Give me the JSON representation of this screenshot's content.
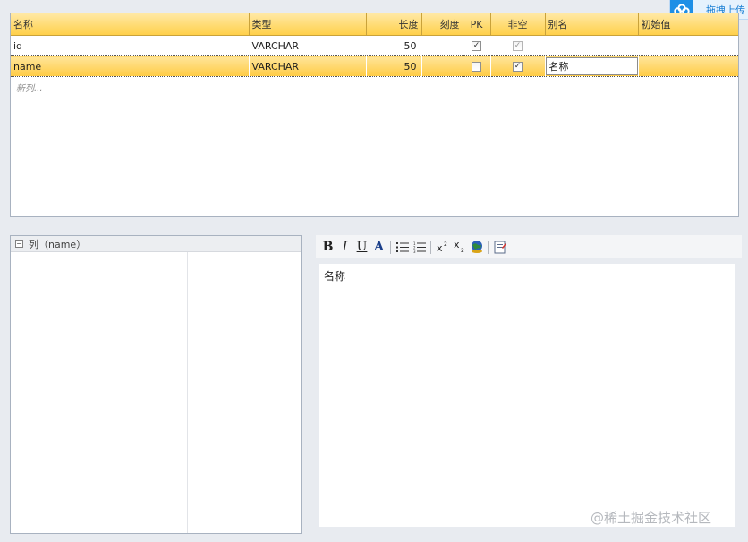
{
  "upload": {
    "label": "拖拽上传"
  },
  "grid": {
    "headers": {
      "name": "名称",
      "type": "类型",
      "length": "长度",
      "scale": "刻度",
      "pk": "PK",
      "notnull": "非空",
      "alias": "别名",
      "default": "初始值"
    },
    "rows": [
      {
        "name": "id",
        "type": "VARCHAR",
        "length": "50",
        "scale": "",
        "pk": true,
        "notnull": true,
        "alias": "",
        "default": ""
      },
      {
        "name": "name",
        "type": "VARCHAR",
        "length": "50",
        "scale": "",
        "pk": false,
        "notnull": true,
        "alias": "名称",
        "default": ""
      }
    ],
    "new_row_placeholder": "新列..."
  },
  "property_panel": {
    "title": "列（name）"
  },
  "editor": {
    "content": "名称"
  },
  "toolbar": {
    "bold": "B",
    "italic": "I",
    "underline": "U",
    "font_color": "A",
    "bullets": "bulleted-list-icon",
    "numbers": "numbered-list-icon",
    "superscript": "superscript-icon",
    "subscript": "subscript-icon",
    "link": "link-globe-icon",
    "source": "source-edit-icon"
  },
  "watermark": "@稀土掘金技术社区"
}
